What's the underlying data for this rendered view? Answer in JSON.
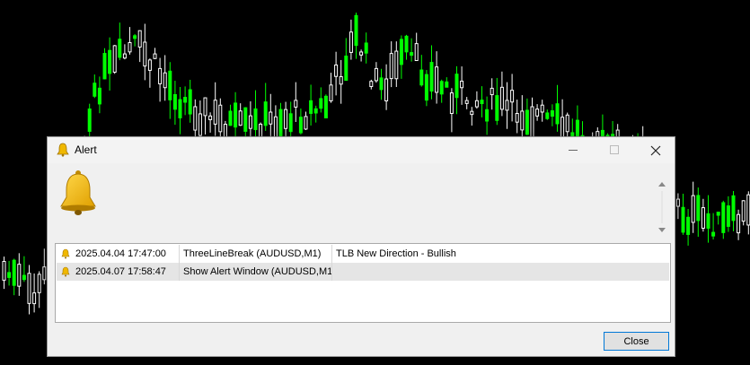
{
  "window": {
    "title": "Alert",
    "close_button_label": "Close"
  },
  "alerts": [
    {
      "time": "2025.04.04 17:47:00",
      "source": "ThreeLineBreak (AUDUSD,M1)",
      "message": "TLB New Direction - Bullish"
    },
    {
      "time": "2025.04.07 17:58:47",
      "source": "Show Alert Window (AUDUSD,M1)",
      "message": ""
    }
  ],
  "colors": {
    "bull": "#00ff00",
    "bear": "#ffffff",
    "accent": "#0078d7",
    "bell": "#f0b800"
  },
  "icons": [
    "bell-icon",
    "minimize-icon",
    "maximize-icon",
    "close-icon",
    "scroll-up-icon",
    "scroll-down-icon"
  ]
}
